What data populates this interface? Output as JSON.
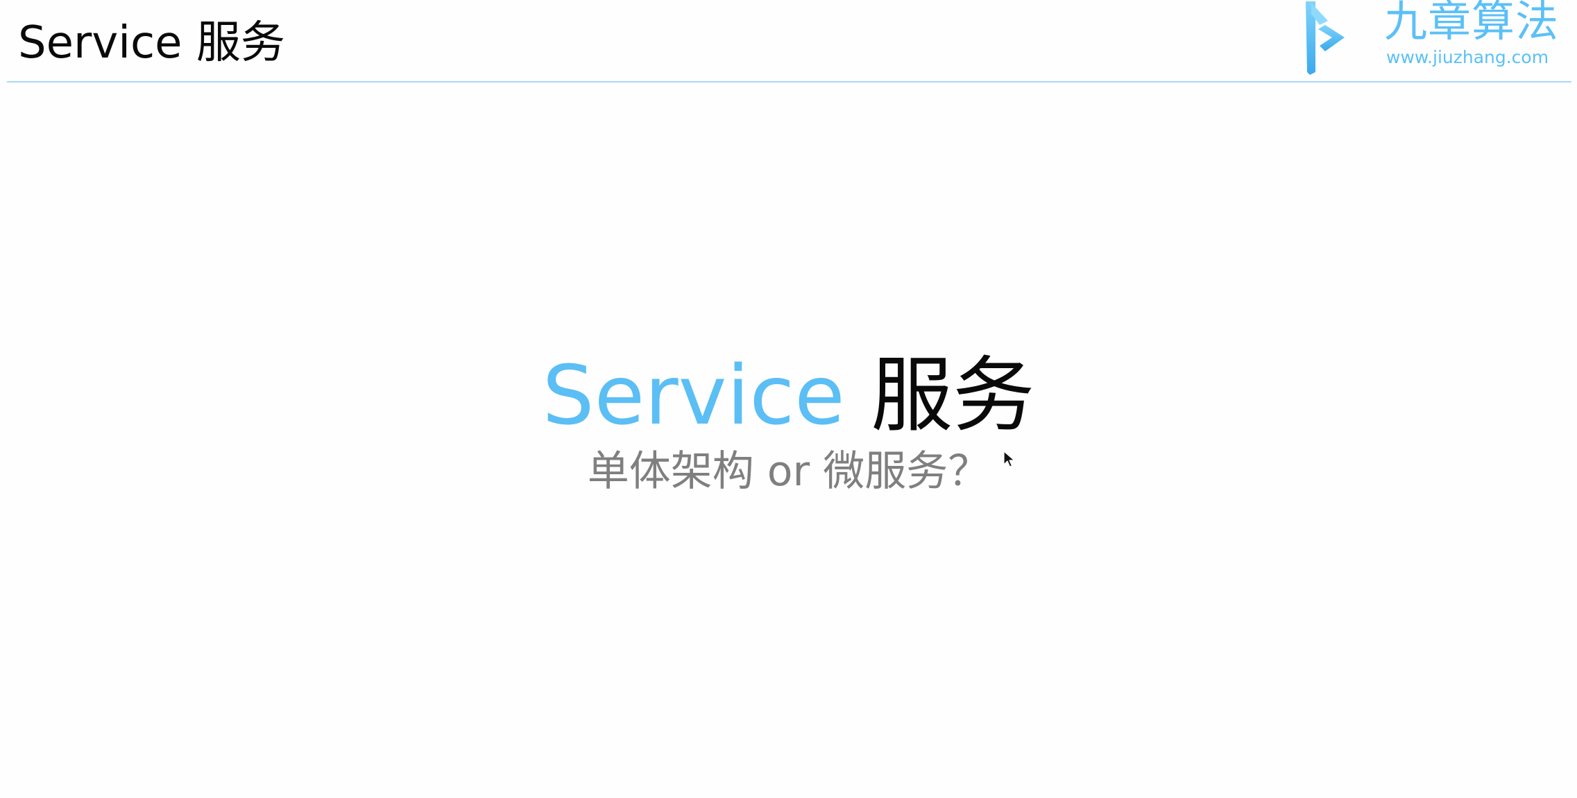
{
  "header": {
    "title": "Service 服务"
  },
  "logo": {
    "name": "九章算法",
    "url": "www.jiuzhang.com",
    "icon": "jiuzhang-logo-icon",
    "color": "#5bc0f7"
  },
  "slide": {
    "title_en": "Service",
    "title_zh": "服务",
    "subtitle": "单体架构 or 微服务？"
  },
  "colors": {
    "accent": "#5bbef5",
    "rule": "#a9d8f3",
    "subtitle": "#7f7f7f",
    "text": "#0a0a0a"
  },
  "cursor": {
    "icon": "mouse-pointer-icon"
  }
}
